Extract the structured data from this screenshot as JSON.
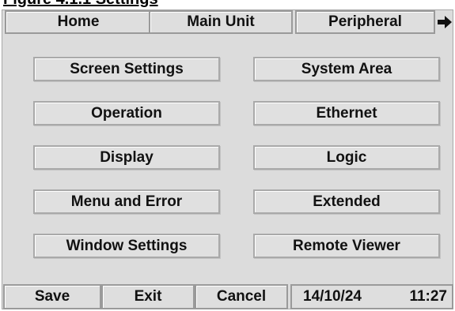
{
  "header": {
    "caption": "Figure 4.1.1 Settings"
  },
  "tabs": [
    {
      "label": "Home"
    },
    {
      "label": "Main Unit"
    },
    {
      "label": "Peripheral"
    }
  ],
  "tab_scroll_icon": "arrow-right-icon",
  "menu": {
    "left": [
      {
        "label": "Screen Settings"
      },
      {
        "label": "Operation"
      },
      {
        "label": "Display"
      },
      {
        "label": "Menu and Error"
      },
      {
        "label": "Window Settings"
      }
    ],
    "right": [
      {
        "label": "System Area"
      },
      {
        "label": "Ethernet"
      },
      {
        "label": "Logic"
      },
      {
        "label": "Extended"
      },
      {
        "label": "Remote Viewer"
      }
    ]
  },
  "footer": {
    "save_label": "Save",
    "exit_label": "Exit",
    "cancel_label": "Cancel",
    "date": "14/10/24",
    "time": "11:27"
  }
}
